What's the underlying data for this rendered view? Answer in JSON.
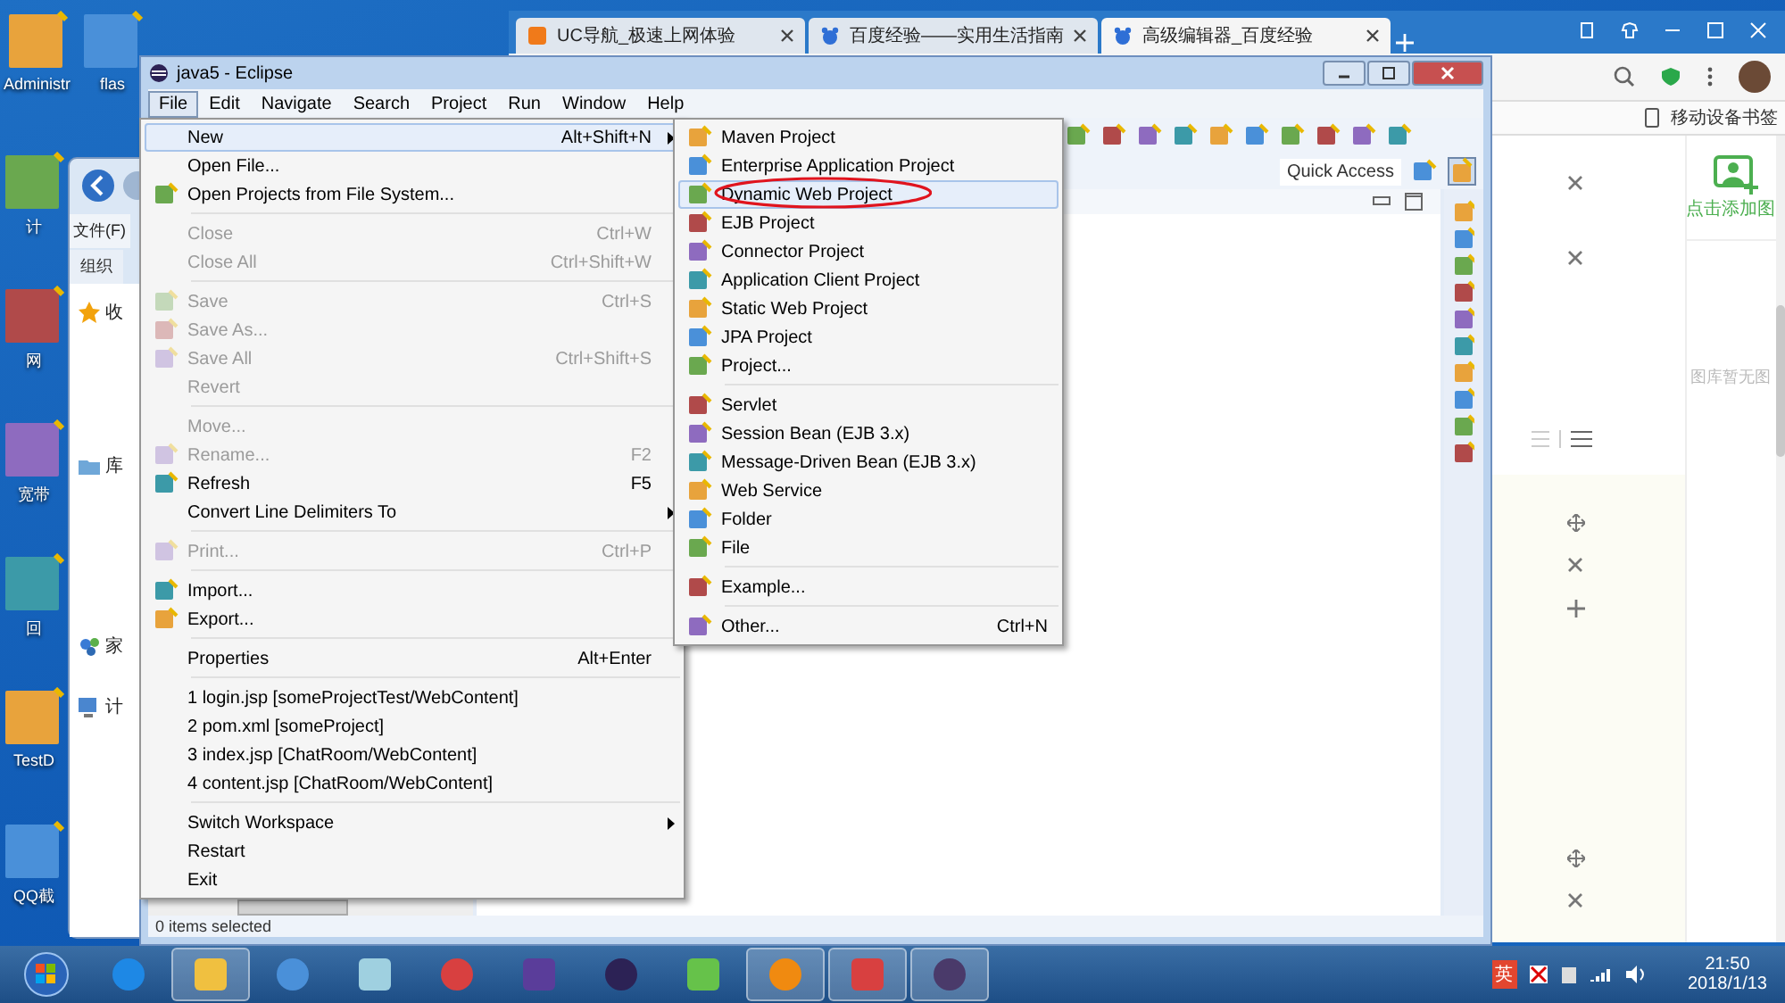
{
  "desktop_icons": [
    {
      "label": "Administr"
    },
    {
      "label": "flas"
    },
    {
      "label": "计"
    },
    {
      "label": "网"
    },
    {
      "label": "宽带"
    },
    {
      "label": "回"
    },
    {
      "label": "TestD"
    },
    {
      "label": "QQ截"
    }
  ],
  "browser": {
    "tabs": [
      {
        "label": "UC导航_极速上网体验",
        "selected": false
      },
      {
        "label": "百度经验——实用生活指南",
        "selected": false
      },
      {
        "label": "高级编辑器_百度经验",
        "selected": true
      }
    ],
    "bookmark_label": "移动设备书签",
    "add_image_label": "点击添加图",
    "gallery_empty_text": "图库暂无图"
  },
  "explorer": {
    "menu_label": "文件(F)",
    "organize_label": "组织",
    "nav_items": [
      {
        "label": "收"
      },
      {
        "label": "库"
      },
      {
        "label": "家"
      },
      {
        "label": "计"
      }
    ]
  },
  "eclipse": {
    "title": "java5 - Eclipse",
    "menu": [
      {
        "label": "File",
        "selected": true
      },
      {
        "label": "Edit",
        "selected": false
      },
      {
        "label": "Navigate",
        "selected": false
      },
      {
        "label": "Search",
        "selected": false
      },
      {
        "label": "Project",
        "selected": false
      },
      {
        "label": "Run",
        "selected": false
      },
      {
        "label": "Window",
        "selected": false
      },
      {
        "label": "Help",
        "selected": false
      }
    ],
    "quick_access": "Quick Access",
    "status_bar": "0 items selected"
  },
  "file_menu": {
    "groups": [
      [
        {
          "label": "New",
          "shortcut": "Alt+Shift+N",
          "submenu": true,
          "selected": true,
          "disabled": false,
          "kind": "plain"
        },
        {
          "label": "Open File...",
          "selected": false,
          "disabled": false,
          "kind": "plain"
        },
        {
          "label": "Open Projects from File System...",
          "selected": false,
          "disabled": false,
          "kind": "icon"
        }
      ],
      [
        {
          "label": "Close",
          "shortcut": "Ctrl+W",
          "selected": false,
          "disabled": true,
          "kind": "plain"
        },
        {
          "label": "Close All",
          "shortcut": "Ctrl+Shift+W",
          "selected": false,
          "disabled": true,
          "kind": "plain"
        }
      ],
      [
        {
          "label": "Save",
          "shortcut": "Ctrl+S",
          "selected": false,
          "disabled": true,
          "kind": "icon"
        },
        {
          "label": "Save As...",
          "selected": false,
          "disabled": true,
          "kind": "icon"
        },
        {
          "label": "Save All",
          "shortcut": "Ctrl+Shift+S",
          "selected": false,
          "disabled": true,
          "kind": "icon"
        },
        {
          "label": "Revert",
          "selected": false,
          "disabled": true,
          "kind": "plain"
        }
      ],
      [
        {
          "label": "Move...",
          "selected": false,
          "disabled": true,
          "kind": "plain"
        },
        {
          "label": "Rename...",
          "shortcut": "F2",
          "selected": false,
          "disabled": true,
          "kind": "icon"
        },
        {
          "label": "Refresh",
          "shortcut": "F5",
          "selected": false,
          "disabled": false,
          "kind": "icon"
        },
        {
          "label": "Convert Line Delimiters To",
          "submenu": true,
          "selected": false,
          "disabled": false,
          "kind": "plain"
        }
      ],
      [
        {
          "label": "Print...",
          "shortcut": "Ctrl+P",
          "selected": false,
          "disabled": true,
          "kind": "icon"
        }
      ],
      [
        {
          "label": "Import...",
          "selected": false,
          "disabled": false,
          "kind": "icon"
        },
        {
          "label": "Export...",
          "selected": false,
          "disabled": false,
          "kind": "icon"
        }
      ],
      [
        {
          "label": "Properties",
          "shortcut": "Alt+Enter",
          "selected": false,
          "disabled": false,
          "kind": "plain"
        }
      ],
      [
        {
          "label": "1 login.jsp  [someProjectTest/WebContent]",
          "selected": false,
          "disabled": false,
          "kind": "plain"
        },
        {
          "label": "2 pom.xml  [someProject]",
          "selected": false,
          "disabled": false,
          "kind": "plain"
        },
        {
          "label": "3 index.jsp  [ChatRoom/WebContent]",
          "selected": false,
          "disabled": false,
          "kind": "plain"
        },
        {
          "label": "4 content.jsp  [ChatRoom/WebContent]",
          "selected": false,
          "disabled": false,
          "kind": "plain"
        }
      ],
      [
        {
          "label": "Switch Workspace",
          "submenu": true,
          "selected": false,
          "disabled": false,
          "kind": "plain"
        },
        {
          "label": "Restart",
          "selected": false,
          "disabled": false,
          "kind": "plain"
        },
        {
          "label": "Exit",
          "selected": false,
          "disabled": false,
          "kind": "plain"
        }
      ]
    ]
  },
  "new_submenu": {
    "groups": [
      [
        {
          "label": "Maven Project",
          "selected": false,
          "annotated": false
        },
        {
          "label": "Enterprise Application Project",
          "selected": false,
          "annotated": false
        },
        {
          "label": "Dynamic Web Project",
          "selected": true,
          "annotated": true
        },
        {
          "label": "EJB Project",
          "selected": false,
          "annotated": false
        },
        {
          "label": "Connector Project",
          "selected": false,
          "annotated": false
        },
        {
          "label": "Application Client Project",
          "selected": false,
          "annotated": false
        },
        {
          "label": "Static Web Project",
          "selected": false,
          "annotated": false
        },
        {
          "label": "JPA Project",
          "selected": false,
          "annotated": false
        },
        {
          "label": "Project...",
          "selected": false,
          "annotated": false
        }
      ],
      [
        {
          "label": "Servlet",
          "selected": false,
          "annotated": false
        },
        {
          "label": "Session Bean (EJB 3.x)",
          "selected": false,
          "annotated": false
        },
        {
          "label": "Message-Driven Bean (EJB 3.x)",
          "selected": false,
          "annotated": false
        },
        {
          "label": "Web Service",
          "selected": false,
          "annotated": false
        },
        {
          "label": "Folder",
          "selected": false,
          "annotated": false
        },
        {
          "label": "File",
          "selected": false,
          "annotated": false
        }
      ],
      [
        {
          "label": "Example...",
          "selected": false,
          "annotated": false
        }
      ],
      [
        {
          "label": "Other...",
          "shortcut": "Ctrl+N",
          "selected": false,
          "annotated": false
        }
      ]
    ]
  },
  "taskbar": {
    "apps": [
      {
        "highlighted": false
      },
      {
        "highlighted": true
      },
      {
        "highlighted": false
      },
      {
        "highlighted": false
      },
      {
        "highlighted": false
      },
      {
        "highlighted": false
      },
      {
        "highlighted": false
      },
      {
        "highlighted": false
      },
      {
        "highlighted": true
      },
      {
        "highlighted": true
      },
      {
        "highlighted": true
      }
    ],
    "ime": "英",
    "time": "21:50",
    "date": "2018/1/13"
  }
}
